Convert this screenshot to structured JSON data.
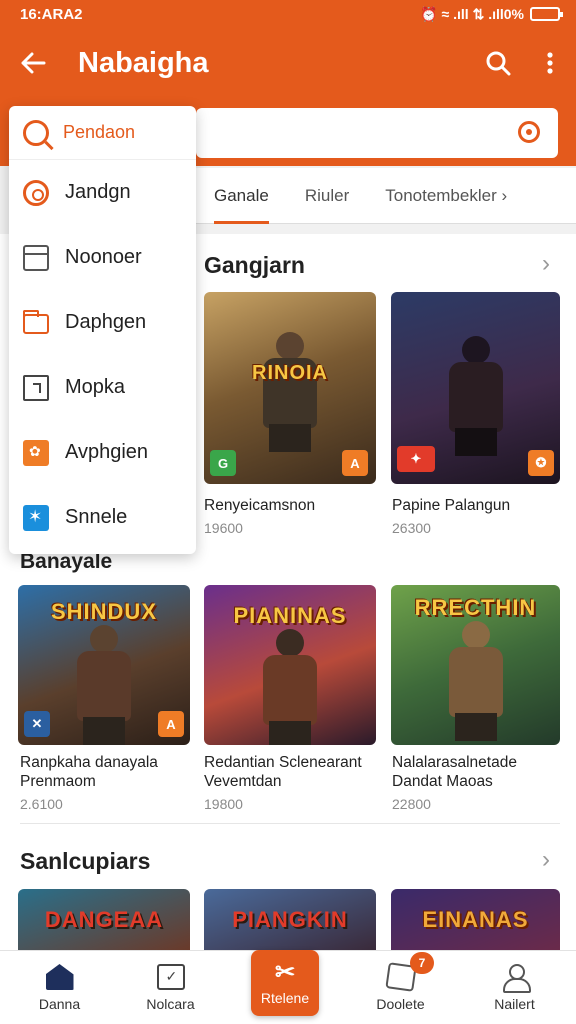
{
  "status_bar": {
    "time": "16:ARA2",
    "indicators": "⏰ ≈ .ıll ⇅ .ıll0%",
    "battery_level": 0
  },
  "app_bar": {
    "title": "Nabaigha",
    "back_icon": "back-arrow-icon",
    "actions": [
      "search-icon",
      "more-vert-icon"
    ]
  },
  "search": {
    "value": "",
    "clear_icon": "clear-icon"
  },
  "tabs": [
    {
      "label": "Ganale",
      "active": true
    },
    {
      "label": "Riuler",
      "active": false
    },
    {
      "label": "Tonotembekler",
      "active": false
    }
  ],
  "tabs_more": "›",
  "dropdown": {
    "header": {
      "label": "Pendaon",
      "icon": "search-icon"
    },
    "items": [
      {
        "label": "Jandgn",
        "icon": "ring-icon"
      },
      {
        "label": "Noonoer",
        "icon": "box-icon"
      },
      {
        "label": "Daphgen",
        "icon": "folder-icon"
      },
      {
        "label": "Mopka",
        "icon": "square-icon"
      },
      {
        "label": "Avphgien",
        "icon": "flower-icon"
      },
      {
        "label": "Snnele",
        "icon": "star-icon"
      }
    ]
  },
  "sections": [
    {
      "title": "Gangjarn",
      "games": [
        {
          "name": "Renyeicamsnon",
          "meta": "19600",
          "art_text": "RINOIA",
          "badge_left": "G",
          "badge_right": "A"
        },
        {
          "name": "Papine Palangun",
          "meta": "26300",
          "art_text": "",
          "badge_left": "✦",
          "badge_right": "✪"
        }
      ]
    },
    {
      "title": "Banayale",
      "games": [
        {
          "name": "Ranpkaha danayala Prenmaom",
          "meta": "2.6100",
          "art_text": "SHINDUX",
          "badge_left": "✕",
          "badge_right": "A"
        },
        {
          "name": "Redantian Sclenearant Vevemtdan",
          "meta": "19800",
          "art_text": "PIANINAS",
          "badge_left": "",
          "badge_right": ""
        },
        {
          "name": "Nalalarasalnetade Dandat Maoas",
          "meta": "22800",
          "art_text": "RRECTHIN",
          "badge_left": "",
          "badge_right": ""
        }
      ]
    },
    {
      "title": "Sanlcupiars",
      "games": [
        {
          "name": "",
          "meta": "",
          "art_text": "DANGEAA",
          "badge_left": "",
          "badge_right": ""
        },
        {
          "name": "",
          "meta": "",
          "art_text": "PIANGKIN",
          "badge_left": "",
          "badge_right": ""
        },
        {
          "name": "",
          "meta": "",
          "art_text": "EINANAS",
          "badge_left": "",
          "badge_right": ""
        }
      ]
    }
  ],
  "chevron": "›",
  "bottom_nav": [
    {
      "label": "Danna",
      "icon": "home-icon"
    },
    {
      "label": "Nolcara",
      "icon": "chat-icon"
    },
    {
      "label": "Rtelene",
      "icon": "center-action-icon"
    },
    {
      "label": "Doolete",
      "icon": "box-icon",
      "badge": "7"
    },
    {
      "label": "Nailert",
      "icon": "user-icon"
    }
  ],
  "colors": {
    "brand": "#e45a1c",
    "text": "#222222",
    "muted": "#8a8a8a",
    "background": "#f1f1f1"
  }
}
